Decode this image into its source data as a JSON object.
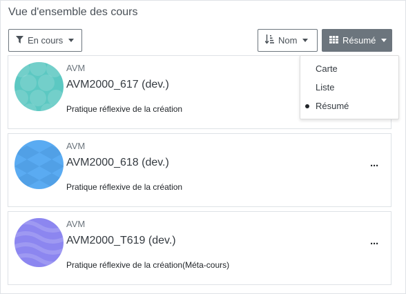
{
  "header": {
    "title": "Vue d'ensemble des cours"
  },
  "toolbar": {
    "filter_label": "En cours",
    "sort_label": "Nom",
    "view_label": "Résumé"
  },
  "view_menu": {
    "items": [
      {
        "label": "Carte",
        "selected": false
      },
      {
        "label": "Liste",
        "selected": false
      },
      {
        "label": "Résumé",
        "selected": true
      }
    ]
  },
  "courses": [
    {
      "category": "AVM",
      "name": "AVM2000_617 (dev.)",
      "summary": "Pratique réflexive de la création",
      "color": "#5cc8c2",
      "pattern": "circles",
      "menu": "···"
    },
    {
      "category": "AVM",
      "name": "AVM2000_618 (dev.)",
      "summary": "Pratique réflexive de la création",
      "color": "#5aabf2",
      "pattern": "diamonds",
      "menu": "···"
    },
    {
      "category": "AVM",
      "name": "AVM2000_T619 (dev.)",
      "summary": "Pratique réflexive de la création(Méta-cours)",
      "color": "#8c86f0",
      "pattern": "waves",
      "menu": "···"
    }
  ],
  "colors": {
    "primary_button": "#6c757d",
    "border": "#dee2e6"
  }
}
